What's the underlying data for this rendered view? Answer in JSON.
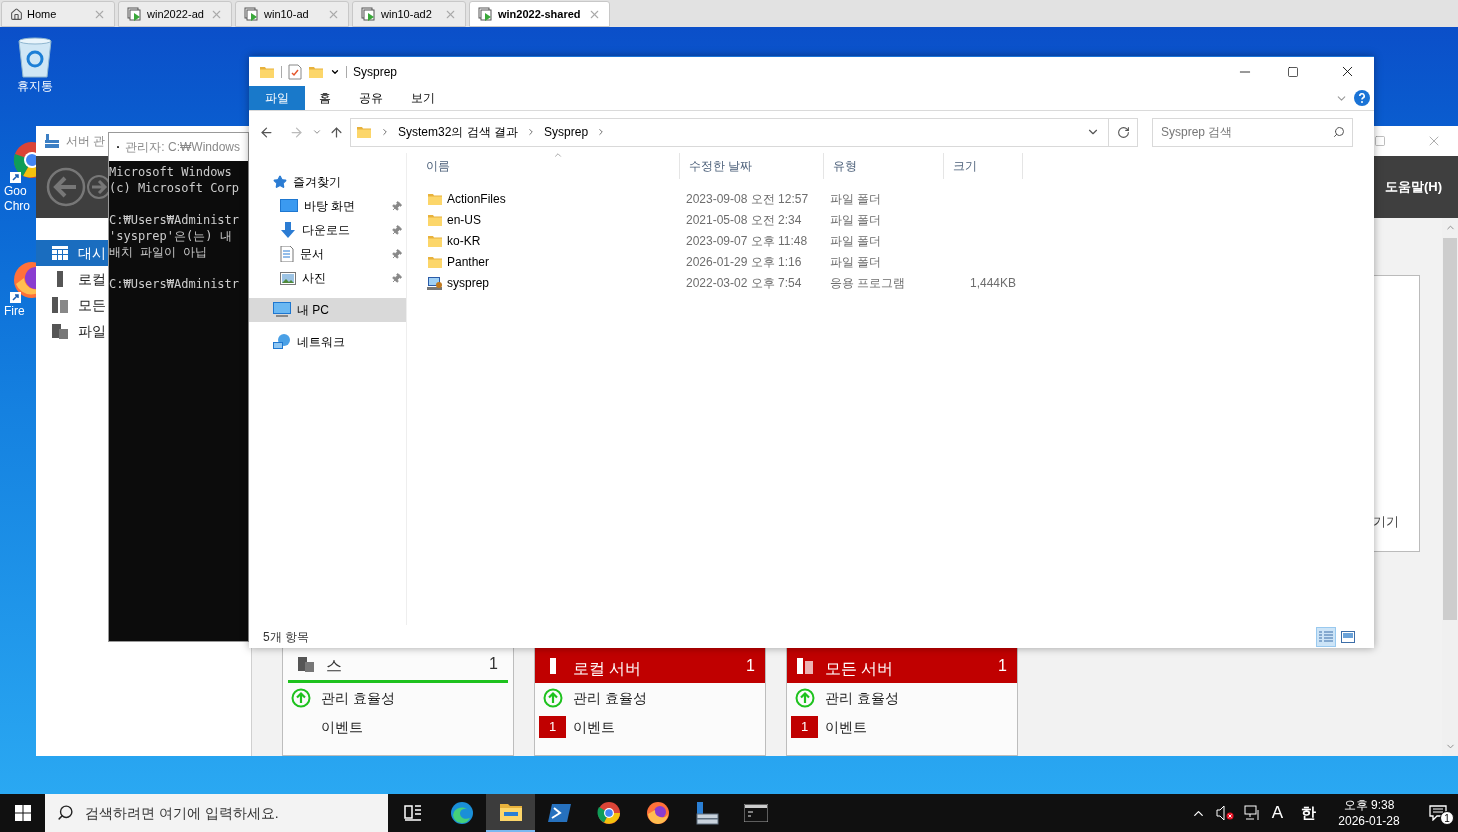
{
  "browser_tabs": [
    {
      "label": "Home",
      "kind": "home",
      "selected": false
    },
    {
      "label": "win2022-ad",
      "kind": "vm",
      "selected": false
    },
    {
      "label": "win10-ad",
      "kind": "vm",
      "selected": false
    },
    {
      "label": "win10-ad2",
      "kind": "vm",
      "selected": false
    },
    {
      "label": "win2022-shared",
      "kind": "vm",
      "selected": true
    }
  ],
  "desktop_icons": [
    {
      "kind": "recycle",
      "lines": [
        "휴지통"
      ]
    },
    {
      "kind": "chrome",
      "lines": [
        "Goo",
        "Chro"
      ]
    },
    {
      "kind": "firefox",
      "lines": [
        "Fire"
      ]
    }
  ],
  "server_manager": {
    "title": "서버 관",
    "help_menu": "도움말(H)",
    "card_text": "기기",
    "nav": [
      {
        "label": "대시",
        "kind": "dashboard",
        "selected": true
      },
      {
        "label": "로컬",
        "kind": "local",
        "selected": false
      },
      {
        "label": "모든",
        "kind": "all",
        "selected": false
      },
      {
        "label": "파일",
        "kind": "files",
        "selected": false
      }
    ],
    "tiles": [
      {
        "title": "스",
        "count": "1",
        "alert": false,
        "kind": "files",
        "rows": [
          {
            "label": "관리 효율성",
            "kind": "ok"
          },
          {
            "label": "이벤트",
            "kind": "plain"
          }
        ]
      },
      {
        "title": "로컬 서버",
        "count": "1",
        "alert": true,
        "kind": "local",
        "rows": [
          {
            "label": "관리 효율성",
            "kind": "ok"
          },
          {
            "label": "이벤트",
            "kind": "badge",
            "badge": "1"
          }
        ]
      },
      {
        "title": "모든 서버",
        "count": "1",
        "alert": true,
        "kind": "all",
        "rows": [
          {
            "label": "관리 효율성",
            "kind": "ok"
          },
          {
            "label": "이벤트",
            "kind": "badge",
            "badge": "1"
          }
        ]
      }
    ]
  },
  "console": {
    "title": "관리자: C:₩Windows",
    "blocks": [
      [
        "Microsoft Windows",
        "(c) Microsoft Corp"
      ],
      [
        "C:₩Users₩Administr",
        "'sysprep'은(는) 내",
        "배치 파일이 아닙"
      ],
      [
        "C:₩Users₩Administr"
      ]
    ]
  },
  "explorer": {
    "title": "Sysprep",
    "ribbon_tabs": [
      {
        "label": "파일",
        "selected": true
      },
      {
        "label": "홈",
        "selected": false
      },
      {
        "label": "공유",
        "selected": false
      },
      {
        "label": "보기",
        "selected": false
      }
    ],
    "breadcrumb": [
      "System32의 검색 결과",
      "Sysprep"
    ],
    "search": {
      "placeholder": "Sysprep 검색"
    },
    "nav": [
      {
        "label": "즐겨찾기",
        "kind": "star",
        "selected": false,
        "children": [
          {
            "label": "바탕 화면",
            "kind": "desktop",
            "pinned": true,
            "selected": false
          },
          {
            "label": "다운로드",
            "kind": "download",
            "pinned": true,
            "selected": false
          },
          {
            "label": "문서",
            "kind": "document",
            "pinned": true,
            "selected": false
          },
          {
            "label": "사진",
            "kind": "picture",
            "pinned": true,
            "selected": false
          }
        ]
      },
      {
        "label": "내 PC",
        "kind": "pc",
        "selected": true
      },
      {
        "label": "네트워크",
        "kind": "network",
        "selected": false
      }
    ],
    "columns": [
      "이름",
      "수정한 날짜",
      "유형",
      "크기"
    ],
    "files": [
      {
        "name": "ActionFiles",
        "kind": "folder",
        "modified": "2023-09-08 오전 12:57",
        "type": "파일 폴더"
      },
      {
        "name": "en-US",
        "kind": "folder",
        "modified": "2021-05-08 오전 2:34",
        "type": "파일 폴더"
      },
      {
        "name": "ko-KR",
        "kind": "folder",
        "modified": "2023-09-07 오후 11:48",
        "type": "파일 폴더"
      },
      {
        "name": "Panther",
        "kind": "folder",
        "modified": "2026-01-29 오후 1:16",
        "type": "파일 폴더"
      },
      {
        "name": "sysprep",
        "kind": "app",
        "modified": "2022-03-02 오후 7:54",
        "type": "응용 프로그램",
        "size": "1,444KB"
      }
    ],
    "status": "5개 항목",
    "view_buttons": [
      {
        "kind": "details",
        "selected": true
      },
      {
        "kind": "thumbnails",
        "selected": false
      }
    ]
  },
  "taskbar": {
    "search": {
      "placeholder": "검색하려면 여기에 입력하세요."
    },
    "apps": [
      {
        "kind": "taskview",
        "active": false
      },
      {
        "kind": "edge",
        "active": false
      },
      {
        "kind": "explorer",
        "active": true
      },
      {
        "kind": "powershell",
        "active": false
      },
      {
        "kind": "chrome",
        "active": false
      },
      {
        "kind": "firefox",
        "active": false
      },
      {
        "kind": "server",
        "active": false
      },
      {
        "kind": "cmd",
        "active": false
      }
    ],
    "ime": "A",
    "hangul": "한",
    "time": "오후 9:38",
    "date": "2026-01-28",
    "notifications": "1"
  }
}
